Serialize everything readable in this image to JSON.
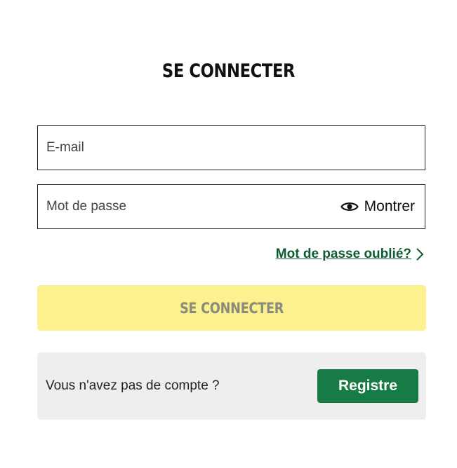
{
  "login": {
    "title": "SE CONNECTER",
    "email": {
      "placeholder": "E-mail",
      "value": ""
    },
    "password": {
      "placeholder": "Mot de passe",
      "value": "",
      "show_label": "Montrer",
      "show_icon": "eye-icon"
    },
    "forgot_password": {
      "label": "Mot de passe oublié?",
      "icon": "chevron-right-icon"
    },
    "submit_label": "SE CONNECTER",
    "signup": {
      "prompt": "Vous n'avez pas de compte ?",
      "button_label": "Registre"
    }
  },
  "colors": {
    "link": "#0f5a2f",
    "submit_background": "#fcf08f",
    "submit_text": "#8a8a7c",
    "register_background": "#177b46",
    "signup_panel": "#eeeeee"
  }
}
